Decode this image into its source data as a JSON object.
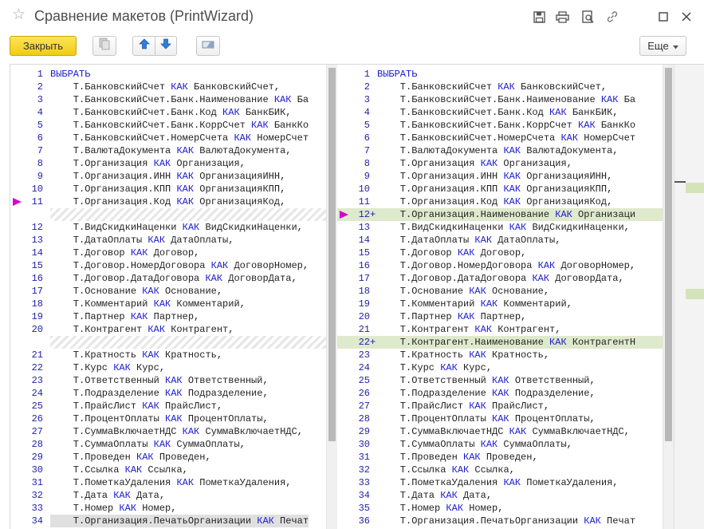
{
  "window": {
    "title": "Сравнение макетов (PrintWizard)"
  },
  "toolbar": {
    "close_label": "Закрыть",
    "more_label": "Еще"
  },
  "colors": {
    "accent_button": "#f5d21e",
    "added_line": "#dfe9cc",
    "keyword": "#1a1ad0",
    "marker": "#d400d4"
  },
  "left_lines": [
    {
      "n": "1",
      "type": "line",
      "parts": [
        {
          "t": "ВЫБРАТЬ",
          "k": true
        }
      ]
    },
    {
      "n": "2",
      "type": "line",
      "parts": [
        {
          "t": "    Т.БанковскийСчет "
        },
        {
          "t": "КАК",
          "k": true
        },
        {
          "t": " БанковскийСчет,"
        }
      ]
    },
    {
      "n": "3",
      "type": "line",
      "parts": [
        {
          "t": "    Т.БанковскийСчет.Банк.Наименование "
        },
        {
          "t": "КАК",
          "k": true
        },
        {
          "t": " Ба"
        }
      ]
    },
    {
      "n": "4",
      "type": "line",
      "parts": [
        {
          "t": "    Т.БанковскийСчет.Банк.Код "
        },
        {
          "t": "КАК",
          "k": true
        },
        {
          "t": " БанкБИК,"
        }
      ]
    },
    {
      "n": "5",
      "type": "line",
      "parts": [
        {
          "t": "    Т.БанковскийСчет.Банк.КоррСчет "
        },
        {
          "t": "КАК",
          "k": true
        },
        {
          "t": " БанкКо"
        }
      ]
    },
    {
      "n": "6",
      "type": "line",
      "parts": [
        {
          "t": "    Т.БанковскийСчет.НомерСчета "
        },
        {
          "t": "КАК",
          "k": true
        },
        {
          "t": " НомерСчет"
        }
      ]
    },
    {
      "n": "7",
      "type": "line",
      "parts": [
        {
          "t": "    Т.ВалютаДокумента "
        },
        {
          "t": "КАК",
          "k": true
        },
        {
          "t": " ВалютаДокумента,"
        }
      ]
    },
    {
      "n": "8",
      "type": "line",
      "parts": [
        {
          "t": "    Т.Организация "
        },
        {
          "t": "КАК",
          "k": true
        },
        {
          "t": " Организация,"
        }
      ]
    },
    {
      "n": "9",
      "type": "line",
      "parts": [
        {
          "t": "    Т.Организация.ИНН "
        },
        {
          "t": "КАК",
          "k": true
        },
        {
          "t": " ОрганизацияИНН,"
        }
      ]
    },
    {
      "n": "10",
      "type": "line",
      "parts": [
        {
          "t": "    Т.Организация.КПП "
        },
        {
          "t": "КАК",
          "k": true
        },
        {
          "t": " ОрганизацияКПП,"
        }
      ]
    },
    {
      "n": "11",
      "type": "line",
      "arrow": true,
      "parts": [
        {
          "t": "    Т.Организация.Код "
        },
        {
          "t": "КАК",
          "k": true
        },
        {
          "t": " ОрганизацияКод,"
        }
      ]
    },
    {
      "n": "",
      "type": "placeholder"
    },
    {
      "n": "12",
      "type": "line",
      "parts": [
        {
          "t": "    Т.ВидСкидкиНаценки "
        },
        {
          "t": "КАК",
          "k": true
        },
        {
          "t": " ВидСкидкиНаценки,"
        }
      ]
    },
    {
      "n": "13",
      "type": "line",
      "parts": [
        {
          "t": "    Т.ДатаОплаты "
        },
        {
          "t": "КАК",
          "k": true
        },
        {
          "t": " ДатаОплаты,"
        }
      ]
    },
    {
      "n": "14",
      "type": "line",
      "parts": [
        {
          "t": "    Т.Договор "
        },
        {
          "t": "КАК",
          "k": true
        },
        {
          "t": " Договор,"
        }
      ]
    },
    {
      "n": "15",
      "type": "line",
      "parts": [
        {
          "t": "    Т.Договор.НомерДоговора "
        },
        {
          "t": "КАК",
          "k": true
        },
        {
          "t": " ДоговорНомер,"
        }
      ]
    },
    {
      "n": "16",
      "type": "line",
      "parts": [
        {
          "t": "    Т.Договор.ДатаДоговора "
        },
        {
          "t": "КАК",
          "k": true
        },
        {
          "t": " ДоговорДата,"
        }
      ]
    },
    {
      "n": "17",
      "type": "line",
      "parts": [
        {
          "t": "    Т.Основание "
        },
        {
          "t": "КАК",
          "k": true
        },
        {
          "t": " Основание,"
        }
      ]
    },
    {
      "n": "18",
      "type": "line",
      "parts": [
        {
          "t": "    Т.Комментарий "
        },
        {
          "t": "КАК",
          "k": true
        },
        {
          "t": " Комментарий,"
        }
      ]
    },
    {
      "n": "19",
      "type": "line",
      "parts": [
        {
          "t": "    Т.Партнер "
        },
        {
          "t": "КАК",
          "k": true
        },
        {
          "t": " Партнер,"
        }
      ]
    },
    {
      "n": "20",
      "type": "line",
      "parts": [
        {
          "t": "    Т.Контрагент "
        },
        {
          "t": "КАК",
          "k": true
        },
        {
          "t": " Контрагент,"
        }
      ]
    },
    {
      "n": "",
      "type": "placeholder"
    },
    {
      "n": "21",
      "type": "line",
      "parts": [
        {
          "t": "    Т.Кратность "
        },
        {
          "t": "КАК",
          "k": true
        },
        {
          "t": " Кратность,"
        }
      ]
    },
    {
      "n": "22",
      "type": "line",
      "parts": [
        {
          "t": "    Т.Курс "
        },
        {
          "t": "КАК",
          "k": true
        },
        {
          "t": " Курс,"
        }
      ]
    },
    {
      "n": "23",
      "type": "line",
      "parts": [
        {
          "t": "    Т.Ответственный "
        },
        {
          "t": "КАК",
          "k": true
        },
        {
          "t": " Ответственный,"
        }
      ]
    },
    {
      "n": "24",
      "type": "line",
      "parts": [
        {
          "t": "    Т.Подразделение "
        },
        {
          "t": "КАК",
          "k": true
        },
        {
          "t": " Подразделение,"
        }
      ]
    },
    {
      "n": "25",
      "type": "line",
      "parts": [
        {
          "t": "    Т.ПрайсЛист "
        },
        {
          "t": "КАК",
          "k": true
        },
        {
          "t": " ПрайсЛист,"
        }
      ]
    },
    {
      "n": "26",
      "type": "line",
      "parts": [
        {
          "t": "    Т.ПроцентОплаты "
        },
        {
          "t": "КАК",
          "k": true
        },
        {
          "t": " ПроцентОплаты,"
        }
      ]
    },
    {
      "n": "27",
      "type": "line",
      "parts": [
        {
          "t": "    Т.СуммаВключаетНДС "
        },
        {
          "t": "КАК",
          "k": true
        },
        {
          "t": " СуммаВключаетНДС,"
        }
      ]
    },
    {
      "n": "28",
      "type": "line",
      "parts": [
        {
          "t": "    Т.СуммаОплаты "
        },
        {
          "t": "КАК",
          "k": true
        },
        {
          "t": " СуммаОплаты,"
        }
      ]
    },
    {
      "n": "29",
      "type": "line",
      "parts": [
        {
          "t": "    Т.Проведен "
        },
        {
          "t": "КАК",
          "k": true
        },
        {
          "t": " Проведен,"
        }
      ]
    },
    {
      "n": "30",
      "type": "line",
      "parts": [
        {
          "t": "    Т.Ссылка "
        },
        {
          "t": "КАК",
          "k": true
        },
        {
          "t": " Ссылка,"
        }
      ]
    },
    {
      "n": "31",
      "type": "line",
      "parts": [
        {
          "t": "    Т.ПометкаУдаления "
        },
        {
          "t": "КАК",
          "k": true
        },
        {
          "t": " ПометкаУдаления,"
        }
      ]
    },
    {
      "n": "32",
      "type": "line",
      "parts": [
        {
          "t": "    Т.Дата "
        },
        {
          "t": "КАК",
          "k": true
        },
        {
          "t": " Дата,"
        }
      ]
    },
    {
      "n": "33",
      "type": "line",
      "parts": [
        {
          "t": "    Т.Номер "
        },
        {
          "t": "КАК",
          "k": true
        },
        {
          "t": " Номер,"
        }
      ]
    },
    {
      "n": "34",
      "type": "line",
      "hl": true,
      "parts": [
        {
          "t": "    Т.Организация.ПечатьОрганизации "
        },
        {
          "t": "КАК",
          "k": true
        },
        {
          "t": " Печат"
        }
      ]
    }
  ],
  "right_lines": [
    {
      "n": "1",
      "type": "line",
      "parts": [
        {
          "t": "ВЫБРАТЬ",
          "k": true
        }
      ]
    },
    {
      "n": "2",
      "type": "line",
      "parts": [
        {
          "t": "    Т.БанковскийСчет "
        },
        {
          "t": "КАК",
          "k": true
        },
        {
          "t": " БанковскийСчет,"
        }
      ]
    },
    {
      "n": "3",
      "type": "line",
      "parts": [
        {
          "t": "    Т.БанковскийСчет.Банк.Наименование "
        },
        {
          "t": "КАК",
          "k": true
        },
        {
          "t": " Ба"
        }
      ]
    },
    {
      "n": "4",
      "type": "line",
      "parts": [
        {
          "t": "    Т.БанковскийСчет.Банк.Код "
        },
        {
          "t": "КАК",
          "k": true
        },
        {
          "t": " БанкБИК,"
        }
      ]
    },
    {
      "n": "5",
      "type": "line",
      "parts": [
        {
          "t": "    Т.БанковскийСчет.Банк.КоррСчет "
        },
        {
          "t": "КАК",
          "k": true
        },
        {
          "t": " БанкКо"
        }
      ]
    },
    {
      "n": "6",
      "type": "line",
      "parts": [
        {
          "t": "    Т.БанковскийСчет.НомерСчета "
        },
        {
          "t": "КАК",
          "k": true
        },
        {
          "t": " НомерСчет"
        }
      ]
    },
    {
      "n": "7",
      "type": "line",
      "parts": [
        {
          "t": "    Т.ВалютаДокумента "
        },
        {
          "t": "КАК",
          "k": true
        },
        {
          "t": " ВалютаДокумента,"
        }
      ]
    },
    {
      "n": "8",
      "type": "line",
      "parts": [
        {
          "t": "    Т.Организация "
        },
        {
          "t": "КАК",
          "k": true
        },
        {
          "t": " Организация,"
        }
      ]
    },
    {
      "n": "9",
      "type": "line",
      "parts": [
        {
          "t": "    Т.Организация.ИНН "
        },
        {
          "t": "КАК",
          "k": true
        },
        {
          "t": " ОрганизацияИНН,"
        }
      ]
    },
    {
      "n": "10",
      "type": "line",
      "parts": [
        {
          "t": "    Т.Организация.КПП "
        },
        {
          "t": "КАК",
          "k": true
        },
        {
          "t": " ОрганизацияКПП,"
        }
      ]
    },
    {
      "n": "11",
      "type": "line",
      "parts": [
        {
          "t": "    Т.Организация.Код "
        },
        {
          "t": "КАК",
          "k": true
        },
        {
          "t": " ОрганизацияКод,"
        }
      ]
    },
    {
      "n": "12",
      "type": "added",
      "arrow": true,
      "parts": [
        {
          "t": "    Т.Организация.Наименование "
        },
        {
          "t": "КАК",
          "k": true
        },
        {
          "t": " Организаци"
        }
      ]
    },
    {
      "n": "13",
      "type": "line",
      "parts": [
        {
          "t": "    Т.ВидСкидкиНаценки "
        },
        {
          "t": "КАК",
          "k": true
        },
        {
          "t": " ВидСкидкиНаценки,"
        }
      ]
    },
    {
      "n": "14",
      "type": "line",
      "parts": [
        {
          "t": "    Т.ДатаОплаты "
        },
        {
          "t": "КАК",
          "k": true
        },
        {
          "t": " ДатаОплаты,"
        }
      ]
    },
    {
      "n": "15",
      "type": "line",
      "parts": [
        {
          "t": "    Т.Договор "
        },
        {
          "t": "КАК",
          "k": true
        },
        {
          "t": " Договор,"
        }
      ]
    },
    {
      "n": "16",
      "type": "line",
      "parts": [
        {
          "t": "    Т.Договор.НомерДоговора "
        },
        {
          "t": "КАК",
          "k": true
        },
        {
          "t": " ДоговорНомер,"
        }
      ]
    },
    {
      "n": "17",
      "type": "line",
      "parts": [
        {
          "t": "    Т.Договор.ДатаДоговора "
        },
        {
          "t": "КАК",
          "k": true
        },
        {
          "t": " ДоговорДата,"
        }
      ]
    },
    {
      "n": "18",
      "type": "line",
      "parts": [
        {
          "t": "    Т.Основание "
        },
        {
          "t": "КАК",
          "k": true
        },
        {
          "t": " Основание,"
        }
      ]
    },
    {
      "n": "19",
      "type": "line",
      "parts": [
        {
          "t": "    Т.Комментарий "
        },
        {
          "t": "КАК",
          "k": true
        },
        {
          "t": " Комментарий,"
        }
      ]
    },
    {
      "n": "20",
      "type": "line",
      "parts": [
        {
          "t": "    Т.Партнер "
        },
        {
          "t": "КАК",
          "k": true
        },
        {
          "t": " Партнер,"
        }
      ]
    },
    {
      "n": "21",
      "type": "line",
      "parts": [
        {
          "t": "    Т.Контрагент "
        },
        {
          "t": "КАК",
          "k": true
        },
        {
          "t": " Контрагент,"
        }
      ]
    },
    {
      "n": "22",
      "type": "added",
      "parts": [
        {
          "t": "    Т.Контрагент.Наименование "
        },
        {
          "t": "КАК",
          "k": true
        },
        {
          "t": " КонтрагентН"
        }
      ]
    },
    {
      "n": "23",
      "type": "line",
      "parts": [
        {
          "t": "    Т.Кратность "
        },
        {
          "t": "КАК",
          "k": true
        },
        {
          "t": " Кратность,"
        }
      ]
    },
    {
      "n": "24",
      "type": "line",
      "parts": [
        {
          "t": "    Т.Курс "
        },
        {
          "t": "КАК",
          "k": true
        },
        {
          "t": " Курс,"
        }
      ]
    },
    {
      "n": "25",
      "type": "line",
      "parts": [
        {
          "t": "    Т.Ответственный "
        },
        {
          "t": "КАК",
          "k": true
        },
        {
          "t": " Ответственный,"
        }
      ]
    },
    {
      "n": "26",
      "type": "line",
      "parts": [
        {
          "t": "    Т.Подразделение "
        },
        {
          "t": "КАК",
          "k": true
        },
        {
          "t": " Подразделение,"
        }
      ]
    },
    {
      "n": "27",
      "type": "line",
      "parts": [
        {
          "t": "    Т.ПрайсЛист "
        },
        {
          "t": "КАК",
          "k": true
        },
        {
          "t": " ПрайсЛист,"
        }
      ]
    },
    {
      "n": "28",
      "type": "line",
      "parts": [
        {
          "t": "    Т.ПроцентОплаты "
        },
        {
          "t": "КАК",
          "k": true
        },
        {
          "t": " ПроцентОплаты,"
        }
      ]
    },
    {
      "n": "29",
      "type": "line",
      "parts": [
        {
          "t": "    Т.СуммаВключаетНДС "
        },
        {
          "t": "КАК",
          "k": true
        },
        {
          "t": " СуммаВключаетНДС,"
        }
      ]
    },
    {
      "n": "30",
      "type": "line",
      "parts": [
        {
          "t": "    Т.СуммаОплаты "
        },
        {
          "t": "КАК",
          "k": true
        },
        {
          "t": " СуммаОплаты,"
        }
      ]
    },
    {
      "n": "31",
      "type": "line",
      "parts": [
        {
          "t": "    Т.Проведен "
        },
        {
          "t": "КАК",
          "k": true
        },
        {
          "t": " Проведен,"
        }
      ]
    },
    {
      "n": "32",
      "type": "line",
      "parts": [
        {
          "t": "    Т.Ссылка "
        },
        {
          "t": "КАК",
          "k": true
        },
        {
          "t": " Ссылка,"
        }
      ]
    },
    {
      "n": "33",
      "type": "line",
      "parts": [
        {
          "t": "    Т.ПометкаУдаления "
        },
        {
          "t": "КАК",
          "k": true
        },
        {
          "t": " ПометкаУдаления,"
        }
      ]
    },
    {
      "n": "34",
      "type": "line",
      "parts": [
        {
          "t": "    Т.Дата "
        },
        {
          "t": "КАК",
          "k": true
        },
        {
          "t": " Дата,"
        }
      ]
    },
    {
      "n": "35",
      "type": "line",
      "parts": [
        {
          "t": "    Т.Номер "
        },
        {
          "t": "КАК",
          "k": true
        },
        {
          "t": " Номер,"
        }
      ]
    },
    {
      "n": "36",
      "type": "line",
      "parts": [
        {
          "t": "    Т.Организация.ПечатьОрганизации "
        },
        {
          "t": "КАК",
          "k": true
        },
        {
          "t": " Печат"
        }
      ]
    }
  ],
  "added_marker": "+",
  "icons": {
    "favorite": "star-icon",
    "save": "save-icon",
    "print": "print-icon",
    "preview": "preview-icon",
    "link": "link-icon",
    "maximize": "maximize-icon",
    "close": "close-icon"
  }
}
